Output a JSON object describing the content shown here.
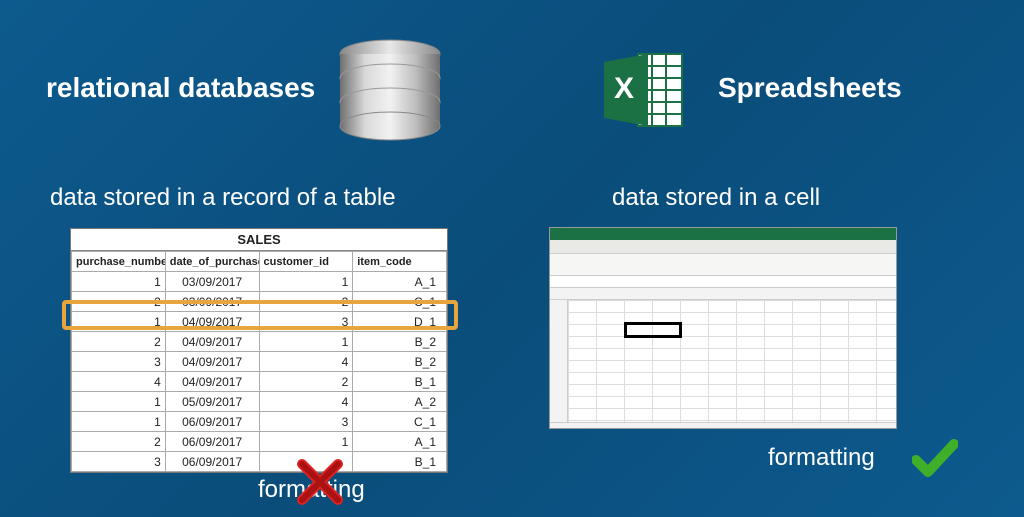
{
  "left": {
    "title": "relational databases",
    "subtitle": "data stored in a record of a table",
    "formatting_label": "formatting",
    "table": {
      "name": "SALES",
      "columns": [
        "purchase_number",
        "date_of_purchase",
        "customer_id",
        "item_code"
      ],
      "rows": [
        {
          "purchase_number": "1",
          "date_of_purchase": "03/09/2017",
          "customer_id": "1",
          "item_code": "A_1"
        },
        {
          "purchase_number": "2",
          "date_of_purchase": "03/09/2017",
          "customer_id": "2",
          "item_code": "C_1"
        },
        {
          "purchase_number": "1",
          "date_of_purchase": "04/09/2017",
          "customer_id": "3",
          "item_code": "D_1"
        },
        {
          "purchase_number": "2",
          "date_of_purchase": "04/09/2017",
          "customer_id": "1",
          "item_code": "B_2"
        },
        {
          "purchase_number": "3",
          "date_of_purchase": "04/09/2017",
          "customer_id": "4",
          "item_code": "B_2"
        },
        {
          "purchase_number": "4",
          "date_of_purchase": "04/09/2017",
          "customer_id": "2",
          "item_code": "B_1"
        },
        {
          "purchase_number": "1",
          "date_of_purchase": "05/09/2017",
          "customer_id": "4",
          "item_code": "A_2"
        },
        {
          "purchase_number": "1",
          "date_of_purchase": "06/09/2017",
          "customer_id": "3",
          "item_code": "C_1"
        },
        {
          "purchase_number": "2",
          "date_of_purchase": "06/09/2017",
          "customer_id": "1",
          "item_code": "A_1"
        },
        {
          "purchase_number": "3",
          "date_of_purchase": "06/09/2017",
          "customer_id": "",
          "item_code": "B_1"
        }
      ],
      "highlighted_row_index": 2
    },
    "formatting_allowed": false
  },
  "right": {
    "title": "Spreadsheets",
    "subtitle": "data stored in a cell",
    "formatting_label": "formatting",
    "formatting_allowed": true,
    "excel_icon_letter": "X"
  }
}
